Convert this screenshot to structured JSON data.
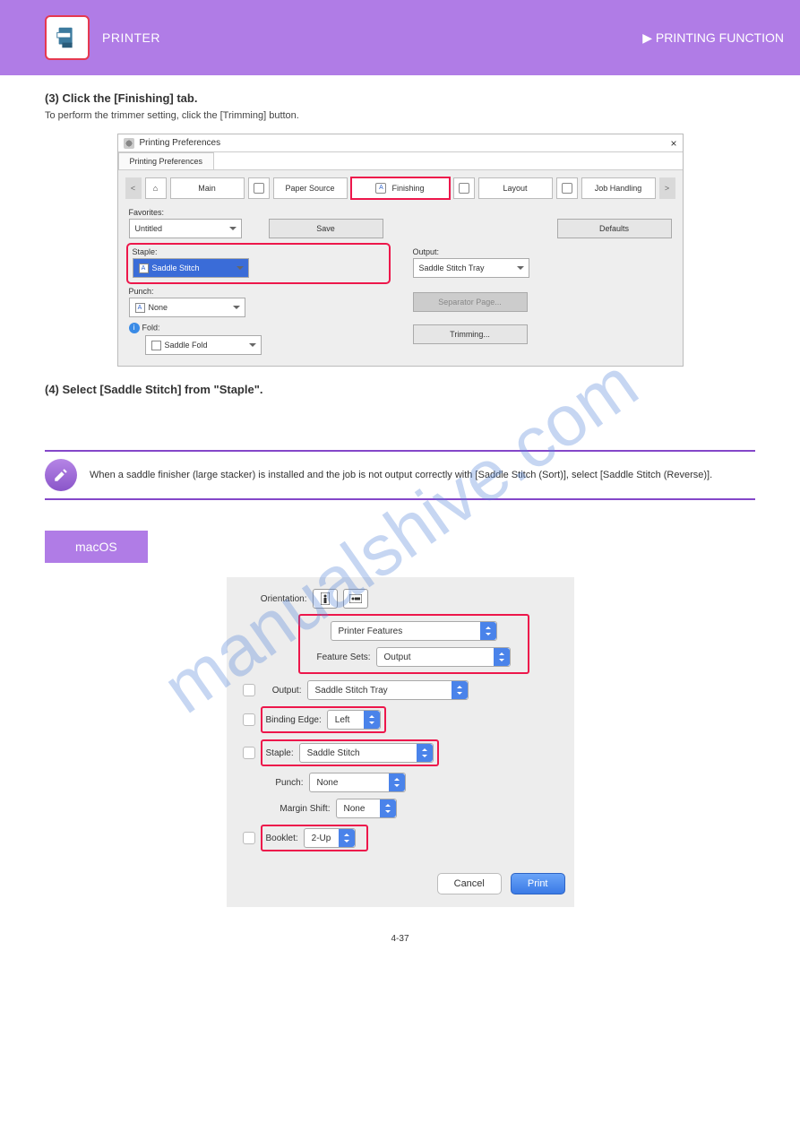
{
  "header": {
    "title": "PRINTER",
    "page": "▶ PRINTING FUNCTION"
  },
  "step3": {
    "heading": "(3) Click the [Finishing] tab.",
    "sub": "To perform the trimmer setting, click the [Trimming] button."
  },
  "step4": {
    "heading": "(4) Select [Saddle Stitch] from \"Staple\"."
  },
  "win": {
    "title": "Printing Preferences",
    "subtab": "Printing Preferences",
    "close": "×",
    "nav_prev": "<",
    "nav_next": ">",
    "tabs": {
      "main": "Main",
      "paper": "Paper Source",
      "finishing": "Finishing",
      "layout": "Layout",
      "job": "Job Handling"
    },
    "fav_label": "Favorites:",
    "fav_value": "Untitled",
    "save": "Save",
    "defaults": "Defaults",
    "staple_label": "Staple:",
    "staple_value": "Saddle Stitch",
    "punch_label": "Punch:",
    "punch_value": "None",
    "fold_label": "Fold:",
    "fold_value": "Saddle Fold",
    "output_label": "Output:",
    "output_value": "Saddle Stitch Tray",
    "separator": "Separator Page...",
    "trimming": "Trimming...",
    "icon_letter": "A"
  },
  "note": {
    "text": "When a saddle finisher (large stacker) is installed and the job is not output correctly with [Saddle Stitch (Sort)], select [Saddle Stitch (Reverse)]."
  },
  "macos_label": "macOS",
  "mac": {
    "orientation_label": "Orientation:",
    "printer_features": "Printer Features",
    "feature_sets_label": "Feature Sets:",
    "feature_sets_value": "Output",
    "output_label": "Output:",
    "output_value": "Saddle Stitch Tray",
    "binding_label": "Binding Edge:",
    "binding_value": "Left",
    "staple_label": "Staple:",
    "staple_value": "Saddle Stitch",
    "punch_label": "Punch:",
    "punch_value": "None",
    "margin_label": "Margin Shift:",
    "margin_value": "None",
    "booklet_label": "Booklet:",
    "booklet_value": "2-Up",
    "cancel": "Cancel",
    "print": "Print"
  },
  "watermark": "manualshive.com",
  "page_number": "4-37"
}
